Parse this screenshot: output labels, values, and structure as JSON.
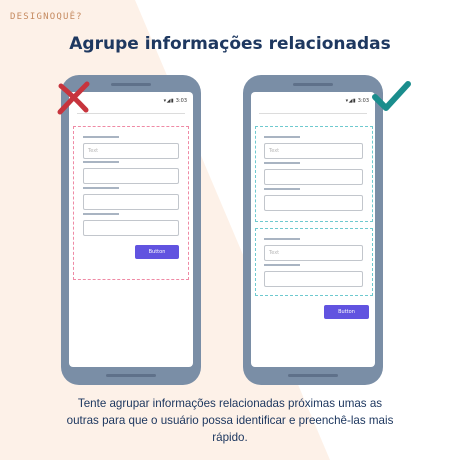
{
  "brand": "DESIGNOQUÊ?",
  "title": "Agrupe informações relacionadas",
  "phone": {
    "status_time": "3:03",
    "status_icons": "▾◢▮"
  },
  "form": {
    "placeholder": "Text",
    "button_label": "Button"
  },
  "marks": {
    "bad": "x-mark-icon",
    "good": "check-mark-icon"
  },
  "colors": {
    "title": "#1e3860",
    "brand": "#c58a60",
    "bad_mark": "#c7343d",
    "good_mark": "#1a8d8d",
    "red_group_border": "#ef8aa5",
    "teal_group_border": "#6fc9cf",
    "button": "#6153e0",
    "phone_body": "#7a8ea6",
    "background_shape": "#fdf1e8"
  },
  "caption": {
    "line1": "Tente agrupar informações relacionadas próximas umas as",
    "line2": "outras para que o usuário possa  identificar e preenchê-las mais",
    "line3": "rápido."
  }
}
